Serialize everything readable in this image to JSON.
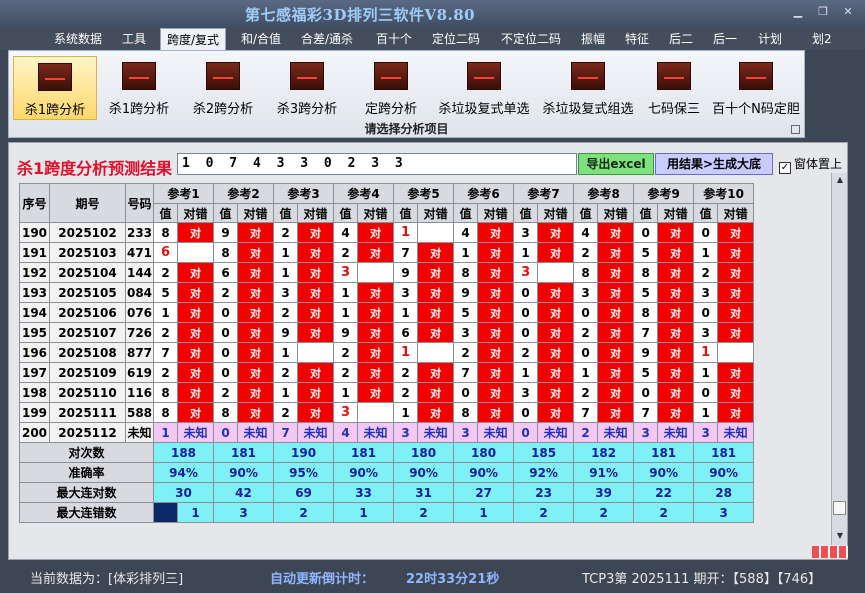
{
  "title": "第七感福彩3D排列三软件V8.80",
  "menu": [
    "系统数据",
    "工具",
    "跨度/复式",
    "和/合值",
    "合差/通杀",
    "百十个",
    "定位二码",
    "不定位二码",
    "振幅",
    "特征",
    "后二",
    "后一",
    "计划",
    "划2"
  ],
  "ribbon": {
    "buttons": [
      "杀1跨分析",
      "杀1跨分析",
      "杀2跨分析",
      "杀3跨分析",
      "定跨分析",
      "杀垃圾复式单选",
      "杀垃圾复式组选",
      "七码保三",
      "百十个N码定胆"
    ],
    "caption": "请选择分析项目"
  },
  "result": {
    "title": "杀1跨度分析预测结果",
    "value": "1 0 7 4 3 3 0 2 3 3",
    "export_label": "导出excel",
    "generate_label": "用结果>生成大底",
    "topmost_label": "窗体置上"
  },
  "grid": {
    "headers": [
      "序号",
      "期号",
      "号码"
    ],
    "refs": [
      "参考1",
      "参考2",
      "参考3",
      "参考4",
      "参考5",
      "参考6",
      "参考7",
      "参考8",
      "参考9",
      "参考10"
    ],
    "sub": [
      "值",
      "对错"
    ],
    "rows": [
      {
        "seq": "190",
        "period": "2025102",
        "num": "233",
        "vals": [
          "8",
          "9",
          "2",
          "4",
          "1",
          "4",
          "3",
          "4",
          "0",
          "0"
        ],
        "bad": [
          1,
          1,
          1,
          1,
          0,
          1,
          1,
          1,
          1,
          1
        ],
        "red": [
          0,
          0,
          0,
          0,
          1,
          0,
          0,
          0,
          0,
          0
        ]
      },
      {
        "seq": "191",
        "period": "2025103",
        "num": "471",
        "vals": [
          "6",
          "8",
          "1",
          "2",
          "7",
          "1",
          "1",
          "2",
          "5",
          "1"
        ],
        "bad": [
          0,
          1,
          1,
          1,
          1,
          1,
          1,
          1,
          1,
          1
        ],
        "red": [
          1,
          0,
          0,
          0,
          0,
          0,
          0,
          0,
          0,
          0
        ]
      },
      {
        "seq": "192",
        "period": "2025104",
        "num": "144",
        "vals": [
          "2",
          "6",
          "1",
          "3",
          "9",
          "8",
          "3",
          "8",
          "8",
          "2"
        ],
        "bad": [
          1,
          1,
          1,
          0,
          1,
          1,
          0,
          1,
          1,
          1
        ],
        "red": [
          0,
          0,
          0,
          1,
          0,
          0,
          1,
          0,
          0,
          0
        ]
      },
      {
        "seq": "193",
        "period": "2025105",
        "num": "084",
        "vals": [
          "5",
          "2",
          "3",
          "1",
          "3",
          "9",
          "0",
          "3",
          "5",
          "3"
        ],
        "bad": [
          1,
          1,
          1,
          1,
          1,
          1,
          1,
          1,
          1,
          1
        ],
        "red": [
          0,
          0,
          0,
          0,
          0,
          0,
          0,
          0,
          0,
          0
        ]
      },
      {
        "seq": "194",
        "period": "2025106",
        "num": "076",
        "vals": [
          "1",
          "0",
          "2",
          "1",
          "1",
          "5",
          "0",
          "0",
          "8",
          "0"
        ],
        "bad": [
          1,
          1,
          1,
          1,
          1,
          1,
          1,
          1,
          1,
          1
        ],
        "red": [
          0,
          0,
          0,
          0,
          0,
          0,
          0,
          0,
          0,
          0
        ]
      },
      {
        "seq": "195",
        "period": "2025107",
        "num": "726",
        "vals": [
          "2",
          "0",
          "9",
          "9",
          "6",
          "3",
          "0",
          "2",
          "7",
          "3"
        ],
        "bad": [
          1,
          1,
          1,
          1,
          1,
          1,
          1,
          1,
          1,
          1
        ],
        "red": [
          0,
          0,
          0,
          0,
          0,
          0,
          0,
          0,
          0,
          0
        ]
      },
      {
        "seq": "196",
        "period": "2025108",
        "num": "877",
        "vals": [
          "7",
          "0",
          "1",
          "2",
          "1",
          "2",
          "2",
          "0",
          "9",
          "1"
        ],
        "bad": [
          1,
          1,
          0,
          1,
          0,
          1,
          1,
          1,
          1,
          0
        ],
        "red": [
          0,
          0,
          0,
          0,
          1,
          0,
          0,
          0,
          0,
          1
        ]
      },
      {
        "seq": "197",
        "period": "2025109",
        "num": "619",
        "vals": [
          "2",
          "0",
          "2",
          "2",
          "2",
          "7",
          "1",
          "1",
          "5",
          "1"
        ],
        "bad": [
          1,
          1,
          1,
          1,
          1,
          1,
          1,
          1,
          1,
          1
        ],
        "red": [
          0,
          0,
          0,
          0,
          0,
          0,
          0,
          0,
          0,
          0
        ]
      },
      {
        "seq": "198",
        "period": "2025110",
        "num": "116",
        "vals": [
          "8",
          "2",
          "1",
          "1",
          "2",
          "0",
          "3",
          "2",
          "0",
          "0"
        ],
        "bad": [
          1,
          1,
          1,
          1,
          1,
          1,
          1,
          1,
          1,
          1
        ],
        "red": [
          0,
          0,
          0,
          0,
          0,
          0,
          0,
          0,
          0,
          0
        ]
      },
      {
        "seq": "199",
        "period": "2025111",
        "num": "588",
        "vals": [
          "8",
          "8",
          "2",
          "3",
          "1",
          "8",
          "0",
          "7",
          "7",
          "1"
        ],
        "bad": [
          1,
          1,
          1,
          0,
          1,
          1,
          1,
          1,
          1,
          1
        ],
        "red": [
          0,
          0,
          0,
          1,
          0,
          0,
          0,
          0,
          0,
          0
        ]
      }
    ],
    "mark_ok": "对",
    "next": {
      "seq": "200",
      "period": "2025112",
      "num": "未知",
      "vals": [
        "1",
        "0",
        "7",
        "4",
        "3",
        "3",
        "0",
        "2",
        "3",
        "3"
      ],
      "status": "未知"
    },
    "stats": [
      {
        "label": "对次数",
        "values": [
          "188",
          "181",
          "190",
          "181",
          "180",
          "180",
          "185",
          "182",
          "181",
          "181"
        ]
      },
      {
        "label": "准确率",
        "values": [
          "94%",
          "90%",
          "95%",
          "90%",
          "90%",
          "90%",
          "92%",
          "91%",
          "90%",
          "90%"
        ]
      },
      {
        "label": "最大连对数",
        "values": [
          "30",
          "42",
          "69",
          "33",
          "31",
          "27",
          "23",
          "39",
          "22",
          "28"
        ]
      },
      {
        "label": "最大连错数",
        "values": [
          "1",
          "3",
          "2",
          "1",
          "2",
          "1",
          "2",
          "2",
          "2",
          "3"
        ]
      }
    ]
  },
  "status": {
    "current_label": "当前数据为：[体彩排列三]",
    "countdown_label": "自动更新倒计时：",
    "countdown": "22时33分21秒",
    "draw": "TCP3第 2025111 期开：【588】【746】"
  }
}
